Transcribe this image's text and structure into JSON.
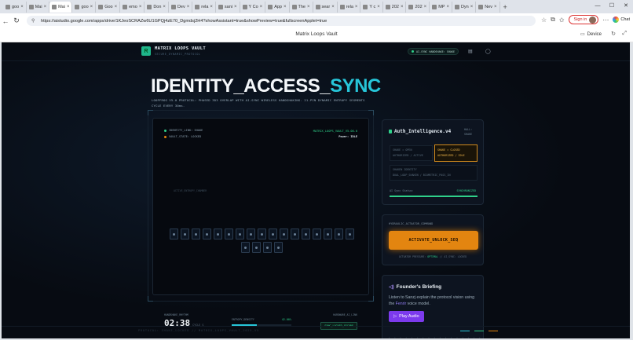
{
  "browser": {
    "tabs": [
      {
        "label": "goo"
      },
      {
        "label": "Mai"
      },
      {
        "label": "Mai"
      },
      {
        "label": "goo"
      },
      {
        "label": "Goo"
      },
      {
        "label": "emo"
      },
      {
        "label": "Don"
      },
      {
        "label": "Dev"
      },
      {
        "label": "rela"
      },
      {
        "label": "sani"
      },
      {
        "label": "Y Co"
      },
      {
        "label": "App"
      },
      {
        "label": "The"
      },
      {
        "label": "sear"
      },
      {
        "label": "rela"
      },
      {
        "label": "Y c"
      },
      {
        "label": "202"
      },
      {
        "label": "202"
      },
      {
        "label": "MP"
      },
      {
        "label": "Dyn"
      },
      {
        "label": "Nev"
      }
    ],
    "url": "https://aistudio.google.com/apps/drive/1KJeoSCRAZw6U1GPQj4zE70_Dgmdsj2H4?showAssistant=true&showPreview=true&fullscreenApplet=true",
    "signin_label": "Sign in",
    "chat_label": "Chat"
  },
  "appbar": {
    "title": "Matrix Loops Vault",
    "device_label": "Device"
  },
  "vault": {
    "brand": "MATRIX LOOPS VAULT",
    "brand_sub": "SECURE_DYNAMIC_PROTOCOL",
    "sync_status": "AI-SYNC HANDSHAKE: SHAKE",
    "hero_plain": "IDENTITY_ACCESS_",
    "hero_accent": "SYNC",
    "hero_desc": "LOOPFROG V5.0 PROTOCOL: PHASED 3D3 OVERLAP WITH AI-SYNC WIRELESS HANDSHAKING. 21-PIN DYNAMIC ENTROPY SEGMENTS CYCLE EVERY 30ms.",
    "panel": {
      "identity_link": "IDENTITY_LINK: SHAKE",
      "vault_state": "VAULT_STATE: LOCKED",
      "vault_id": "MATRIX_LOOPS_VAULT_V5.00.0",
      "power": "Power: IDLE",
      "active_label": "ACTIVE_ENTROPY_CHAMBER",
      "pins_row1": 16,
      "pins_row2": 5,
      "handshake_label": "HANDSHAKE_RHYTHM",
      "timer": "02:38",
      "timer_unit": "CYCLE_S",
      "entropy_label": "ENTROPY_DENSITY",
      "entropy_value": "42.00%",
      "entropy_fill": 0.42,
      "lock_label": "HARDWARE_AI_LINK",
      "lock_status": "SYNC_LOCKED_SECURE"
    },
    "auth": {
      "title": "Auth_Intelligence.v4",
      "tag_line1": "HALL:",
      "tag_line2": "SHAKE",
      "cellA_line1": "SHAKE = OPEN",
      "cellA_line2": "AUTHORIZED / ACTIVE",
      "cellB_line1": "SHAKE = CLOSED",
      "cellB_line2": "AUTHORIZED / IDLE",
      "cellC_line1": "SHAKEN IDENTITY",
      "cellC_line2": "DUAL_LOOP_SHAKEN / BIOMETRIC_PASS_IN",
      "status_label": "AI Sync Status:",
      "status_value": "SYNCHRONIZED"
    },
    "actuator": {
      "label": "HYDRAULIC_ACTUATOR_COMMAND",
      "button": "ACTIVATE_UNLOCK_SEQ",
      "pressure_pre": "ACTUATOR PRESSURE: ",
      "pressure_val": "OPTIMAL",
      "pressure_post": " // AI_SYNC: LOCKED"
    },
    "briefing": {
      "title": "Founder's Briefing",
      "desc_pre": "Listen to Sanzj explain the protocol vision using the ",
      "desc_model": "Fenrir",
      "desc_post": " voice model.",
      "play": "Play Audio",
      "dots": "• • • • • • • • • • • • • • • • • • • • • •"
    },
    "footer": "PROTOCOL: SHAKE_LOCKED // MATRIX_LOOPS_VAULT_2025_V5",
    "colors": {
      "accent": "#27c6d9",
      "green": "#2fd08a",
      "orange": "#e38510",
      "purple": "#7c3aed"
    }
  }
}
